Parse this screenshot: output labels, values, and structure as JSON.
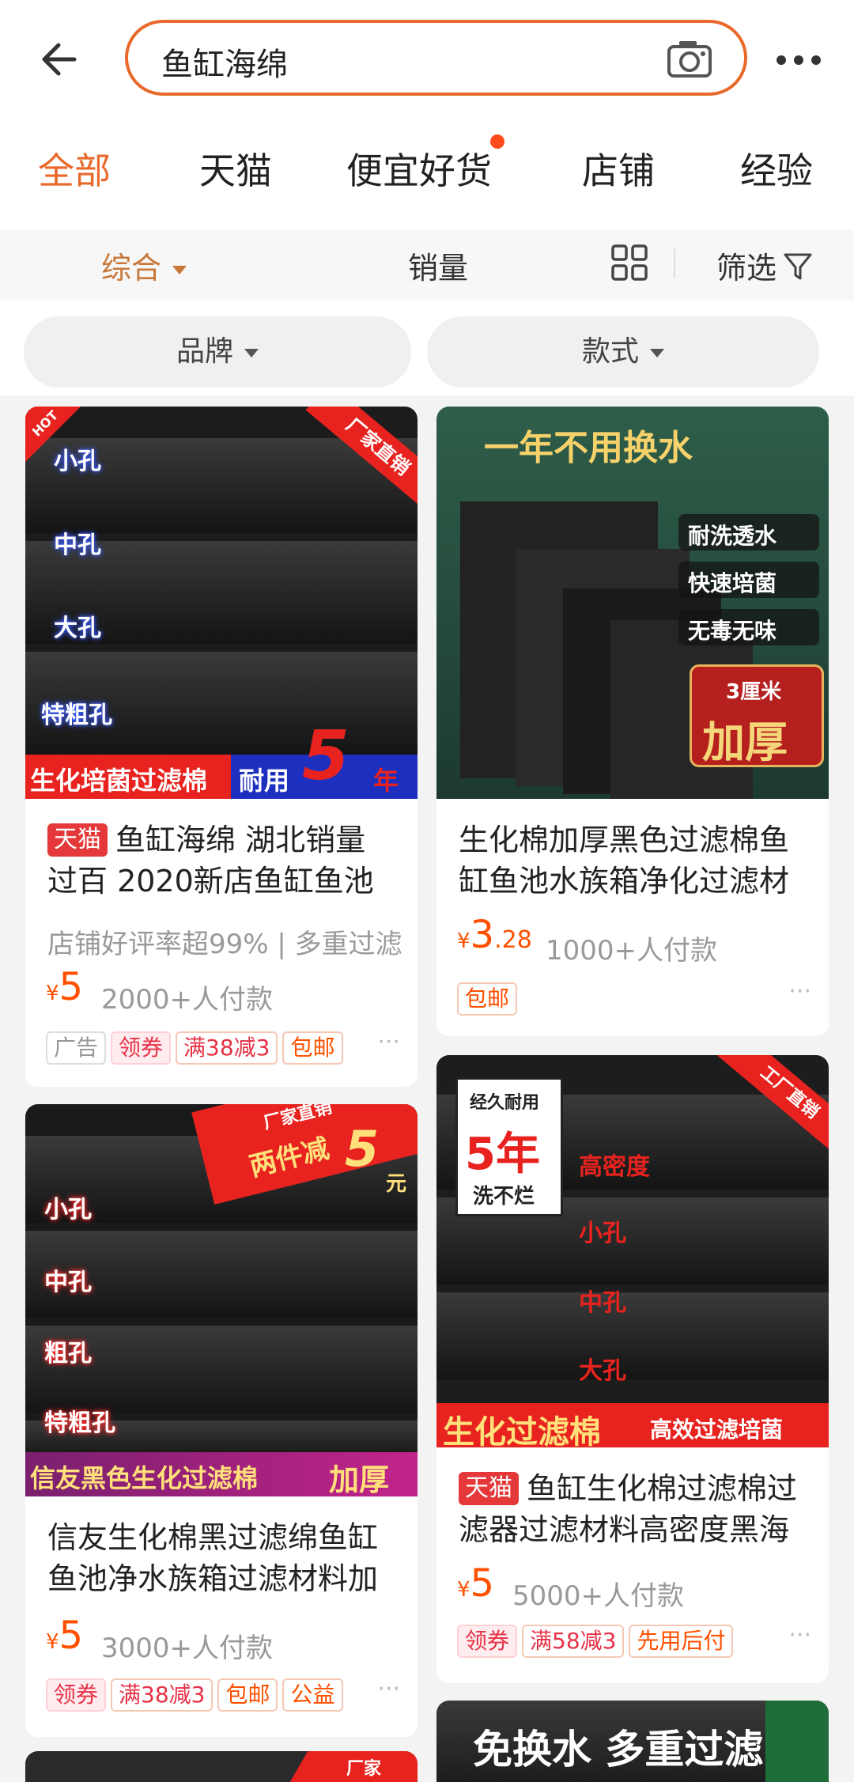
{
  "header": {
    "search_value": "鱼缸海绵",
    "back_icon": "back-arrow-icon",
    "camera_icon": "camera-icon",
    "more_icon": "more-icon"
  },
  "tabs": [
    {
      "label": "全部",
      "active": true
    },
    {
      "label": "天猫",
      "active": false
    },
    {
      "label": "便宜好货",
      "active": false
    },
    {
      "label": "店铺",
      "active": false
    },
    {
      "label": "经验",
      "active": false
    }
  ],
  "sortbar": {
    "comprehensive": "综合",
    "sales": "销量",
    "filter": "筛选"
  },
  "chips": {
    "brand": "品牌",
    "style": "款式"
  },
  "colors": {
    "accent": "#e8692a",
    "price": "#ff5000",
    "tmall": "#e4383a"
  },
  "products": [
    {
      "image_texts": [
        "HOT",
        "厂家直销",
        "小孔",
        "中孔",
        "大孔",
        "特粗孔",
        "生化培菌过滤棉",
        "耐用",
        "5",
        "年"
      ],
      "badge": "天猫",
      "title": "鱼缸海绵 湖北销量过百 2020新店鱼缸鱼池",
      "subtitle": "店铺好评率超99% | 多重过滤",
      "price_symbol": "¥",
      "price_int": "5",
      "price_dec": "",
      "sold": "2000+人付款",
      "tags": [
        "广告",
        "领券",
        "满38减3",
        "包邮"
      ]
    },
    {
      "image_texts": [
        "一年不用换水",
        "耐洗透水",
        "快速培菌",
        "无毒无味",
        "3厘米",
        "加厚"
      ],
      "badge": "",
      "title": "生化棉加厚黑色过滤棉鱼缸鱼池水族箱净化过滤材",
      "price_symbol": "¥",
      "price_int": "3",
      "price_dec": ".28",
      "sold": "1000+人付款",
      "tags": [
        "包邮"
      ]
    },
    {
      "image_texts": [
        "两件减",
        "5",
        "元",
        "厂家直销",
        "小孔",
        "中孔",
        "粗孔",
        "特粗孔",
        "信友黑色生化过滤棉",
        "加厚"
      ],
      "badge": "",
      "title": "信友生化棉黑过滤绵鱼缸鱼池净水族箱过滤材料加",
      "price_symbol": "¥",
      "price_int": "5",
      "price_dec": "",
      "sold": "3000+人付款",
      "tags": [
        "领券",
        "满38减3",
        "包邮",
        "公益"
      ]
    },
    {
      "image_texts": [
        "经久耐用",
        "5年",
        "洗不烂",
        "工厂直销",
        "高密度",
        "小孔",
        "中孔",
        "大孔",
        "生化过滤棉",
        "高效过滤培菌"
      ],
      "badge": "天猫",
      "title": "鱼缸生化棉过滤棉过滤器过滤材料高密度黑海",
      "price_symbol": "¥",
      "price_int": "5",
      "price_dec": "",
      "sold": "5000+人付款",
      "tags": [
        "领券",
        "满58减3",
        "先用后付"
      ]
    },
    {
      "image_texts": [
        "免换水 多重过滤"
      ]
    },
    {
      "image_texts": [
        "厂家"
      ]
    }
  ]
}
